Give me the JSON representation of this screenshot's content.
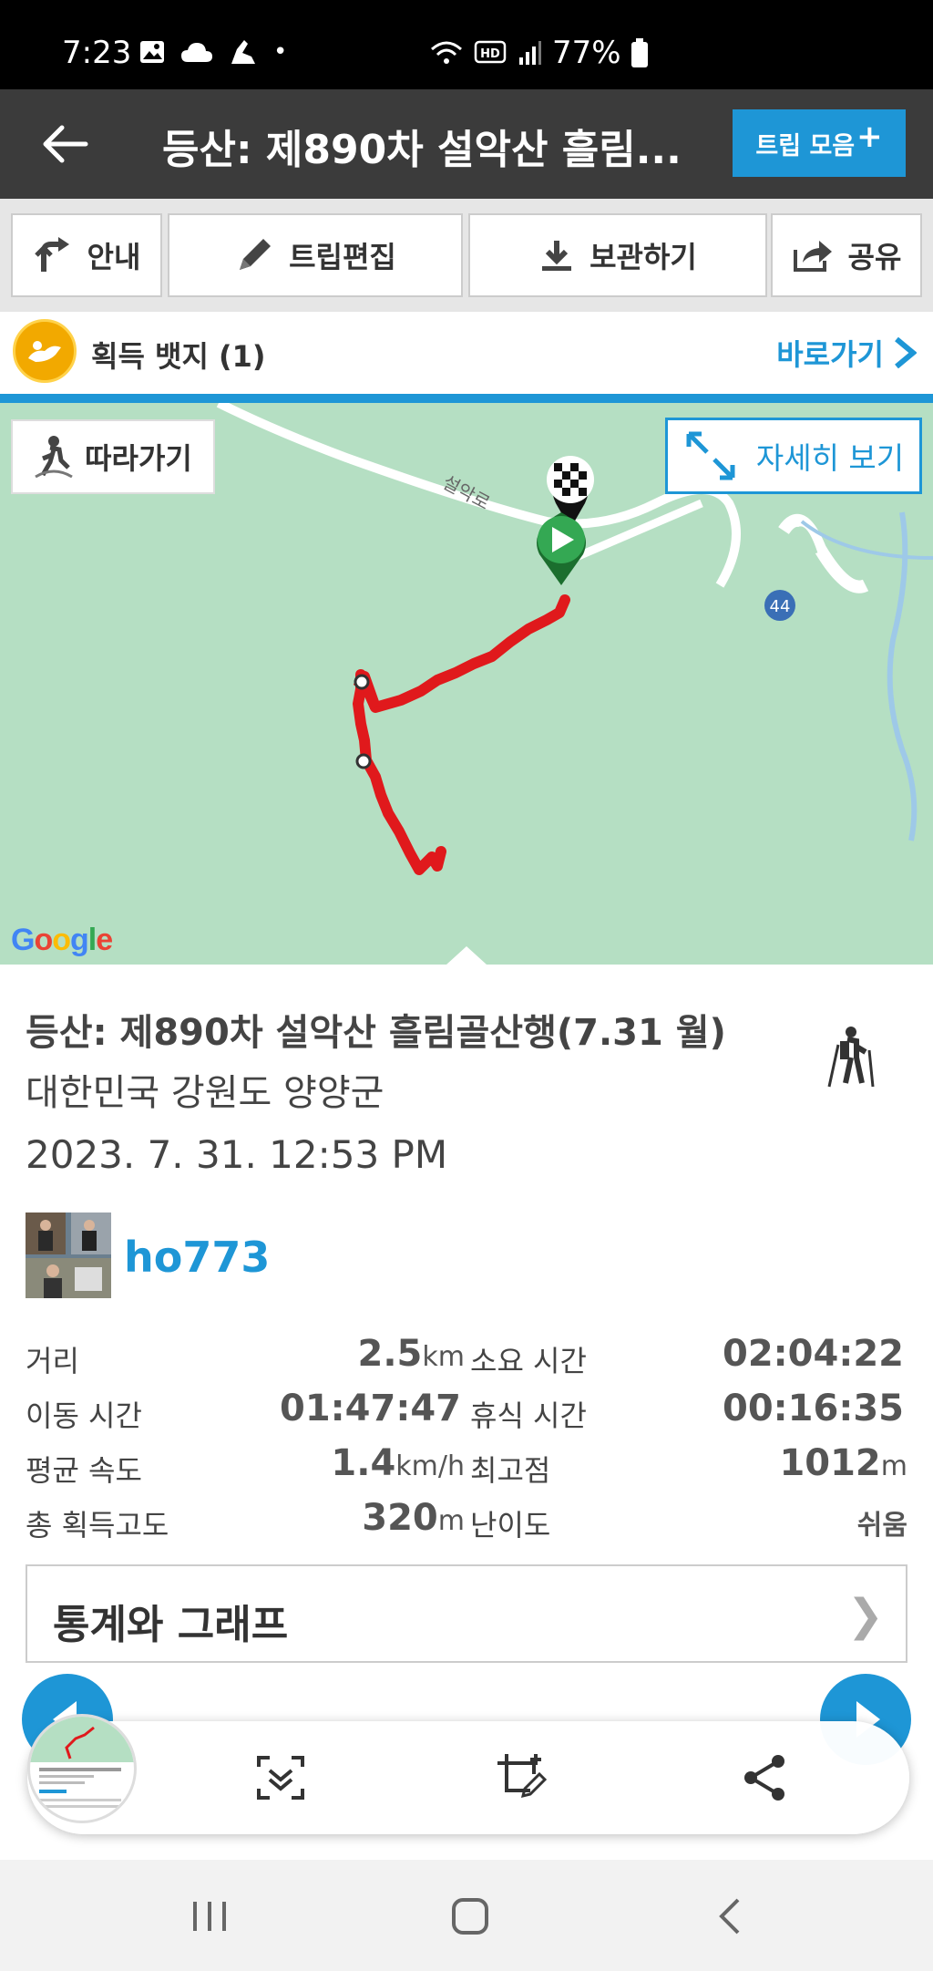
{
  "status_bar": {
    "time": "7:23",
    "battery": "77%"
  },
  "header": {
    "title": "등산: 제890차 설악산 흘림...",
    "trip_collection_label": "트립 모음"
  },
  "toolbar": {
    "guide_label": "안내",
    "edit_label": "트립편집",
    "save_label": "보관하기",
    "share_label": "공유"
  },
  "badge": {
    "label": "획득 뱃지 (1)",
    "link_label": "바로가기"
  },
  "map": {
    "follow_label": "따라가기",
    "detail_label": "자세히 보기",
    "road_label": "설악로",
    "route_number": "44",
    "google_logo": "Google"
  },
  "trip": {
    "title": "등산: 제890차 설악산 흘림골산행(7.31 월)",
    "location": "대한민국 강원도 양양군",
    "datetime": "2023. 7. 31. 12:53 PM",
    "username": "ho773"
  },
  "stats": {
    "distance_label": "거리",
    "distance_value": "2.5",
    "distance_unit": "km",
    "duration_label": "소요 시간",
    "duration_value": "02:04:22",
    "moving_label": "이동 시간",
    "moving_value": "01:47:47",
    "rest_label": "휴식 시간",
    "rest_value": "00:16:35",
    "speed_label": "평균 속도",
    "speed_value": "1.4",
    "speed_unit": "km/h",
    "max_alt_label": "최고점",
    "max_alt_value": "1012",
    "max_alt_unit": "m",
    "gain_label": "총 획득고도",
    "gain_value": "320",
    "gain_unit": "m",
    "difficulty_label": "난이도",
    "difficulty_value": "쉬움"
  },
  "stats_graph_label": "통계와 그래프",
  "colors": {
    "accent": "#1e96d6",
    "header_bg": "#3b3b3b",
    "map_bg": "#b5dfc3",
    "route": "#e0191c"
  }
}
